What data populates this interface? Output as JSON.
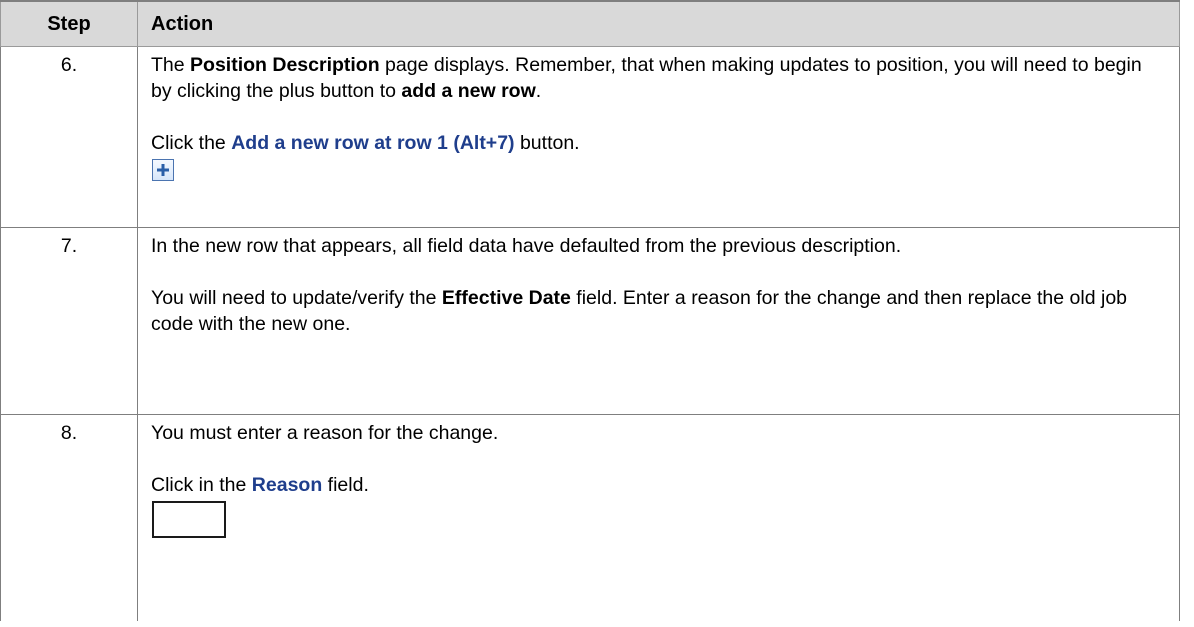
{
  "table": {
    "header": {
      "step": "Step",
      "action": "Action"
    },
    "rows": [
      {
        "step": "6.",
        "p1": [
          "The ",
          "Position Description",
          " page displays. Remember, that when making updates to position, you will need to begin by clicking the plus button to ",
          "add a new row",
          "."
        ],
        "p2": [
          "Click the ",
          "Add a new row at row 1 (Alt+7)",
          " button."
        ],
        "icon": "add-row-plus-icon"
      },
      {
        "step": "7.",
        "p1": [
          "In the new row that appears, all field data have defaulted from the previous description."
        ],
        "p2": [
          "You will need to update/verify the ",
          "Effective Date",
          " field. Enter a reason for the change and then replace the old job code with the new one."
        ]
      },
      {
        "step": "8.",
        "p1": [
          "You must enter a reason for the change."
        ],
        "p2": [
          "Click in the ",
          "Reason",
          " field."
        ]
      }
    ]
  },
  "colors": {
    "header_bg": "#d9d9d9",
    "link_text": "#1f3e8c",
    "border": "#7f7f7f"
  }
}
